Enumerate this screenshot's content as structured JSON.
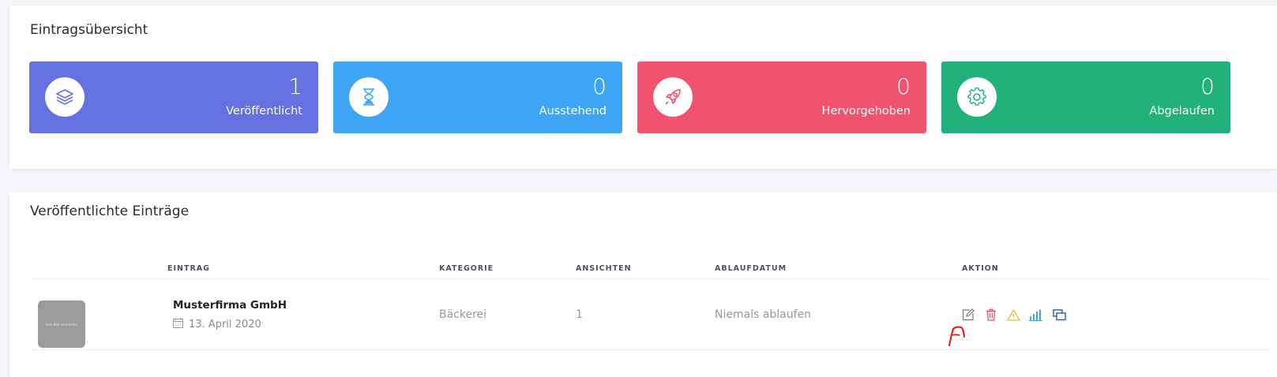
{
  "overview": {
    "title": "Eintragsübersicht",
    "stats": [
      {
        "value": "1",
        "label": "Veröffentlicht",
        "color": "#6570e1",
        "icon": "layers-icon"
      },
      {
        "value": "0",
        "label": "Ausstehend",
        "color": "#3ea5f4",
        "icon": "hourglass-icon"
      },
      {
        "value": "0",
        "label": "Hervorgehoben",
        "color": "#f1526e",
        "icon": "rocket-icon"
      },
      {
        "value": "0",
        "label": "Abgelaufen",
        "color": "#22b07c",
        "icon": "gear-icon"
      }
    ]
  },
  "published": {
    "title": "Veröffentlichte Einträge",
    "columns": [
      "EINTRAG",
      "KATEGORIE",
      "ANSICHTEN",
      "ABLAUFDATUM",
      "AKTION"
    ],
    "rows": [
      {
        "thumb_text": "kein Bild vorhanden",
        "name": "Musterfirma GmbH",
        "date": "13. April 2020",
        "category": "Bäckerei",
        "views": "1",
        "expiry": "Niemals ablaufen",
        "actions": [
          {
            "icon": "edit-icon",
            "color": "#777777"
          },
          {
            "icon": "trash-icon",
            "color": "#e8506a"
          },
          {
            "icon": "warning-icon",
            "color": "#e3c21e"
          },
          {
            "icon": "stats-icon",
            "color": "#3ea5f4"
          },
          {
            "icon": "duplicate-icon",
            "color": "#1f5fb0"
          }
        ]
      }
    ]
  },
  "annotation_color": "#e0141d"
}
